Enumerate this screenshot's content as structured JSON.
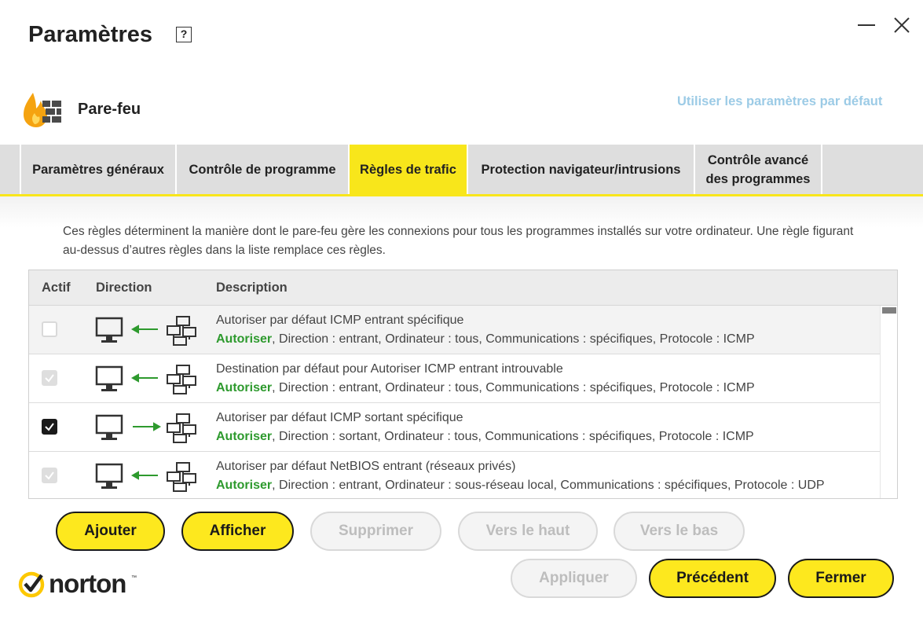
{
  "window": {
    "title": "Paramètres",
    "help_label": "?"
  },
  "section": {
    "label": "Pare-feu",
    "default_link": "Utiliser les paramètres par défaut"
  },
  "tabs": [
    {
      "label": "Paramètres généraux",
      "active": false
    },
    {
      "label": "Contrôle de programme",
      "active": false
    },
    {
      "label": "Règles de trafic",
      "active": true
    },
    {
      "label": "Protection navigateur/intrusions",
      "active": false
    },
    {
      "label": "Contrôle avancé des programmes",
      "active": false
    }
  ],
  "description": "Ces règles déterminent la manière dont le pare-feu gère les connexions pour tous les programmes installés sur votre ordinateur. Une règle figurant au-dessus d’autres règles dans la liste remplace ces règles.",
  "table": {
    "headers": {
      "active": "Actif",
      "direction": "Direction",
      "description": "Description"
    },
    "rows": [
      {
        "title": "Autoriser par défaut ICMP entrant spécifique",
        "action": "Autoriser",
        "details": ", Direction : entrant, Ordinateur : tous, Communications : spécifiques, Protocole : ICMP",
        "checkbox": "unchecked",
        "direction": "inbound"
      },
      {
        "title": "Destination par défaut pour Autoriser ICMP entrant introuvable",
        "action": "Autoriser",
        "details": ", Direction : entrant, Ordinateur : tous, Communications : spécifiques, Protocole : ICMP",
        "checkbox": "checked-disabled",
        "direction": "inbound"
      },
      {
        "title": "Autoriser par défaut ICMP sortant spécifique",
        "action": "Autoriser",
        "details": ", Direction : sortant, Ordinateur : tous, Communications : spécifiques, Protocole : ICMP",
        "checkbox": "checked",
        "direction": "outbound"
      },
      {
        "title": "Autoriser par défaut NetBIOS entrant (réseaux privés)",
        "action": "Autoriser",
        "details": ", Direction : entrant, Ordinateur : sous-réseau local, Communications : spécifiques, Protocole : UDP",
        "checkbox": "checked-disabled",
        "direction": "inbound"
      }
    ]
  },
  "actions": {
    "add": "Ajouter",
    "view": "Afficher",
    "delete": "Supprimer",
    "move_up": "Vers le haut",
    "move_down": "Vers le bas"
  },
  "footer": {
    "apply": "Appliquer",
    "previous": "Précédent",
    "close": "Fermer",
    "brand": "norton"
  },
  "colors": {
    "accent_yellow": "#fde81e",
    "allow_green": "#2e9a2e",
    "link_blue": "#9ccbe6",
    "flame_orange": "#f5a310"
  },
  "icons": [
    "help-icon",
    "minimize-icon",
    "close-icon",
    "firewall-icon",
    "computer-icon",
    "network-icon",
    "arrow-icon",
    "checkmark-icon",
    "norton-logo"
  ]
}
